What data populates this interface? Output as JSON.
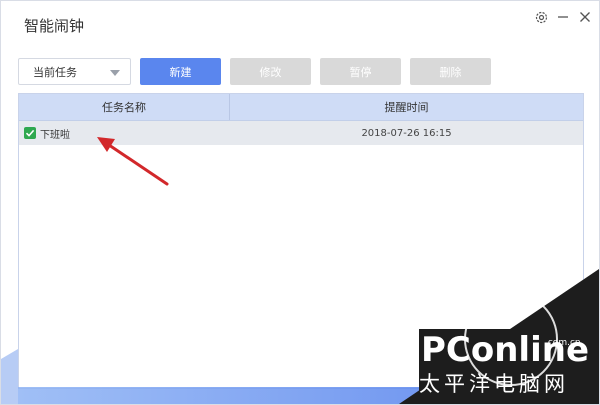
{
  "window": {
    "title": "智能闹钟",
    "controls": {
      "settings": "gear-icon",
      "minimize": "minimize-icon",
      "close": "close-icon"
    }
  },
  "toolbar": {
    "filter_selected": "当前任务",
    "buttons": {
      "new": "新建",
      "edit": "修改",
      "pause": "暂停",
      "delete": "删除"
    }
  },
  "table": {
    "columns": [
      "任务名称",
      "提醒时间"
    ],
    "rows": [
      {
        "name": "下班啦",
        "time": "2018-07-26 16:15",
        "checked": true
      }
    ]
  },
  "watermark": {
    "brand": "PConline",
    "domain": ".com.cn",
    "cn_text": "太平洋电脑网"
  },
  "colors": {
    "primary": "#5a86ee",
    "disabled": "#d9d9d9",
    "header": "#cfdcf6",
    "row_selected": "#e6e9ee",
    "check": "#2fa84f",
    "arrow": "#d2282b"
  }
}
